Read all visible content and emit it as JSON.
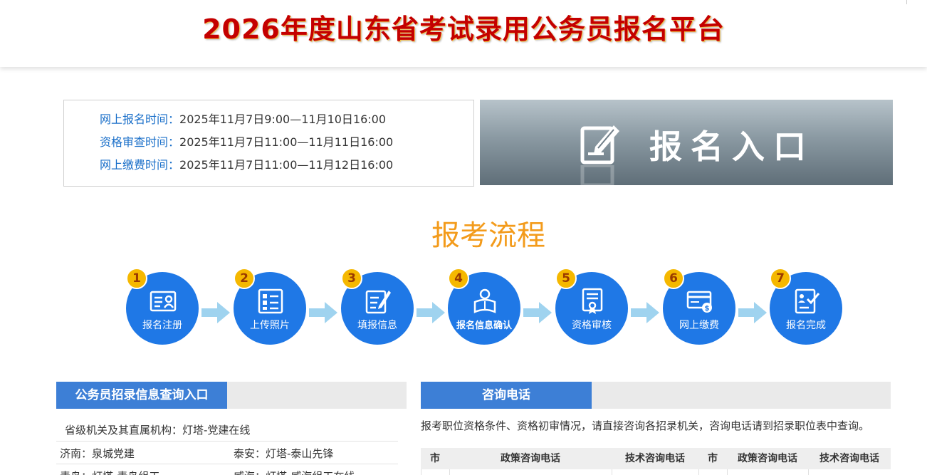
{
  "header": {
    "title": "2026年度山东省考试录用公务员报名平台"
  },
  "times": [
    {
      "label": "网上报名时间：",
      "value": "2025年11月7日9:00—11月10日16:00"
    },
    {
      "label": "资格审查时间：",
      "value": "2025年11月7日11:00—11月11日16:00"
    },
    {
      "label": "网上缴费时间：",
      "value": "2025年11月7日11:00—11月12日16:00"
    }
  ],
  "entry": {
    "label": "报名入口",
    "icon": "edit-document-icon"
  },
  "process": {
    "title": "报考流程",
    "steps": [
      {
        "num": "1",
        "label": "报名注册",
        "icon": "id-card-icon"
      },
      {
        "num": "2",
        "label": "上传照片",
        "icon": "photo-form-icon"
      },
      {
        "num": "3",
        "label": "填报信息",
        "icon": "pen-form-icon"
      },
      {
        "num": "4",
        "label": "报名信息确认",
        "icon": "person-reading-icon"
      },
      {
        "num": "5",
        "label": "资格审核",
        "icon": "certificate-icon"
      },
      {
        "num": "6",
        "label": "网上缴费",
        "icon": "payment-card-icon"
      },
      {
        "num": "7",
        "label": "报名完成",
        "icon": "check-document-icon"
      }
    ]
  },
  "query_panel": {
    "title": "公务员招录信息查询入口",
    "items": {
      "provincial": "省级机关及其直属机构：灯塔-党建在线",
      "jinan": "济南：泉城党建",
      "taian": "泰安：灯塔-泰山先锋",
      "qingdao": "青岛：灯塔-青岛组工",
      "weihai": "威海：灯塔-威海组工在线"
    }
  },
  "consult_panel": {
    "title": "咨询电话",
    "description": "报考职位资格条件、资格初审情况，请直接咨询各招录机关，咨询电话请到招录职位表中查询。",
    "table_headers": [
      "市",
      "政策咨询电话",
      "技术咨询电话",
      "市",
      "政策咨询电话",
      "技术咨询电话"
    ]
  },
  "colors": {
    "brand_red": "#c40000",
    "accent_blue": "#3d7fd6",
    "step_blue": "#1f78e6",
    "badge_yellow": "#f5b800",
    "process_orange": "#f39b1b"
  }
}
